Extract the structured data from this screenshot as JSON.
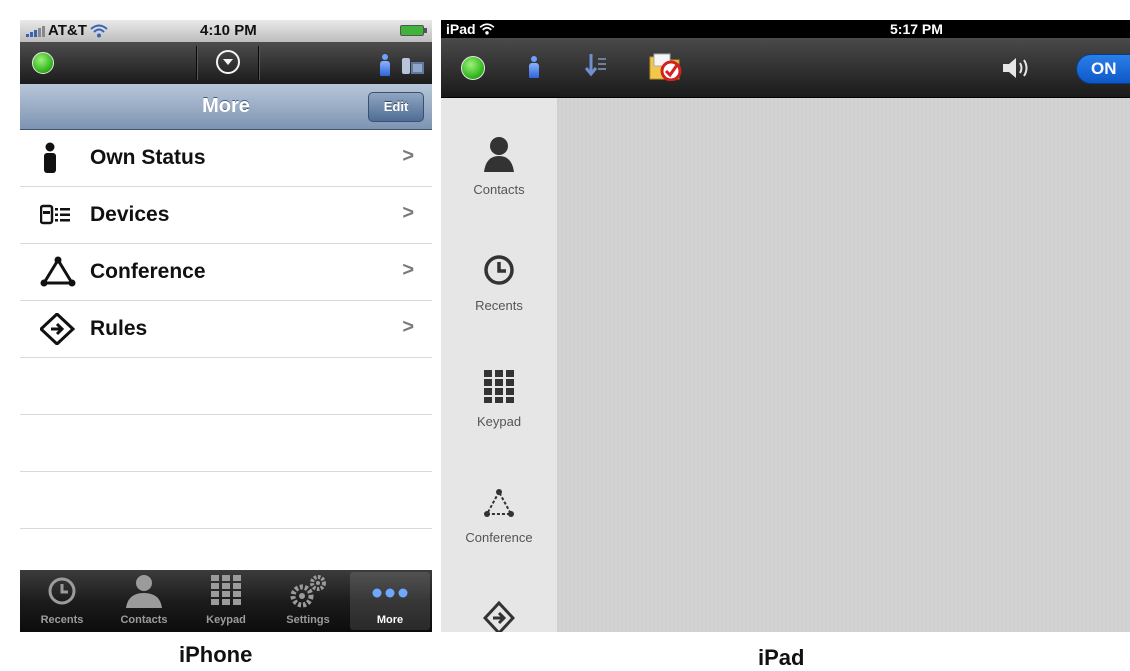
{
  "captions": {
    "iphone": "iPhone",
    "ipad": "iPad"
  },
  "iphone": {
    "status": {
      "carrier": "AT&T",
      "time": "4:10 PM"
    },
    "navbar": {
      "title": "More",
      "edit_label": "Edit"
    },
    "menu": [
      {
        "label": "Own Status",
        "icon": "person-icon"
      },
      {
        "label": "Devices",
        "icon": "devices-icon"
      },
      {
        "label": "Conference",
        "icon": "conference-icon"
      },
      {
        "label": "Rules",
        "icon": "rules-icon"
      }
    ],
    "tabs": [
      {
        "label": "Recents",
        "icon": "clock-icon"
      },
      {
        "label": "Contacts",
        "icon": "person-icon"
      },
      {
        "label": "Keypad",
        "icon": "keypad-icon"
      },
      {
        "label": "Settings",
        "icon": "gears-icon"
      },
      {
        "label": "More",
        "icon": "more-dots-icon",
        "selected": true
      }
    ]
  },
  "ipad": {
    "status": {
      "device": "iPad",
      "time": "5:17 PM"
    },
    "toolbar": {
      "toggle_label": "ON"
    },
    "sidebar": [
      {
        "label": "Contacts",
        "icon": "person-icon"
      },
      {
        "label": "Recents",
        "icon": "clock-icon"
      },
      {
        "label": "Keypad",
        "icon": "keypad-icon"
      },
      {
        "label": "Conference",
        "icon": "conference-icon"
      },
      {
        "label": "",
        "icon": "rules-icon"
      }
    ]
  },
  "colors": {
    "status_online": "#31b51c",
    "navbar": "#8fa4be",
    "toggle": "#1a6fe0"
  }
}
